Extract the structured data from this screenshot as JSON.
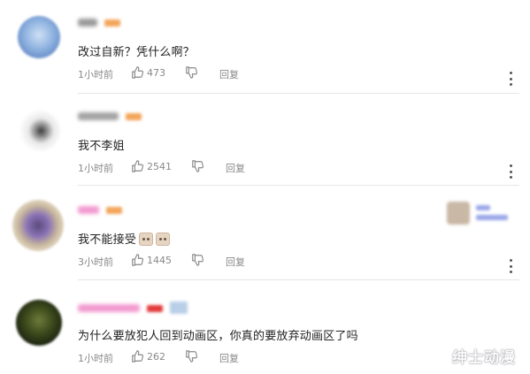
{
  "comments": [
    {
      "text": "改过自新？凭什么啊？",
      "time": "1小时前",
      "likes": "473",
      "reply_label": "回复"
    },
    {
      "text": "我不李姐",
      "time": "1小时前",
      "likes": "2541",
      "reply_label": "回复"
    },
    {
      "text": "我不能接受",
      "time": "3小时前",
      "likes": "1445",
      "reply_label": "回复"
    },
    {
      "text": "为什么要放犯人回到动画区，你真的要放弃动画区了吗",
      "time": "1小时前",
      "likes": "262",
      "reply_label": "回复"
    }
  ],
  "watermark": "绅士动漫",
  "icons": {
    "like": "thumbs-up-icon",
    "dislike": "thumbs-down-icon",
    "more": "more-vertical-icon",
    "emoji": "cat-emoji-icon"
  },
  "colors": {
    "text": "#222222",
    "meta": "#888888",
    "divider": "#e5e5e5"
  }
}
